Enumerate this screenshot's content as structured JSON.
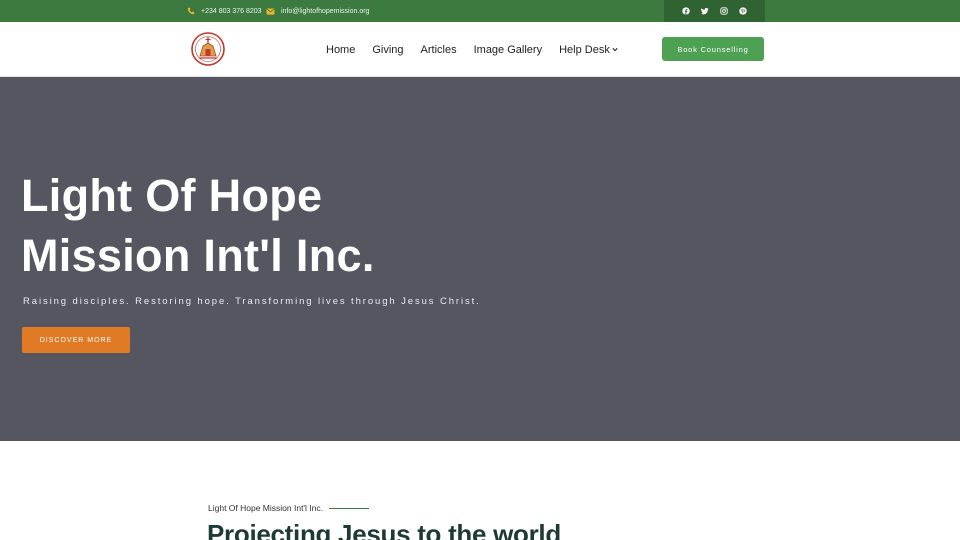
{
  "topbar": {
    "phone": "+234 803 376 8203",
    "email": "info@lightofhopemission.org",
    "icons": [
      "phone-icon",
      "envelope-icon"
    ],
    "social": [
      "facebook-icon",
      "twitter-icon",
      "instagram-icon",
      "pinterest-icon"
    ],
    "color": "#3d7a3f"
  },
  "header": {
    "nav": [
      {
        "label": "Home"
      },
      {
        "label": "Giving"
      },
      {
        "label": "Articles"
      },
      {
        "label": "Image Gallery"
      },
      {
        "label": "Help Desk"
      }
    ],
    "cta_label": "Book Counselling",
    "cta_color": "#4ea152"
  },
  "hero": {
    "title_line1": "Light Of Hope",
    "title_line2": "Mission Int'l Inc.",
    "subtitle": "Raising disciples. Restoring hope. Transforming lives through Jesus Christ.",
    "button_label": "DISCOVER MORE",
    "button_color": "#e07a24",
    "background": "#565660"
  },
  "intro": {
    "eyebrow": "Light Of Hope Mission Int'l Inc.",
    "title": "Projecting Jesus to the world"
  }
}
